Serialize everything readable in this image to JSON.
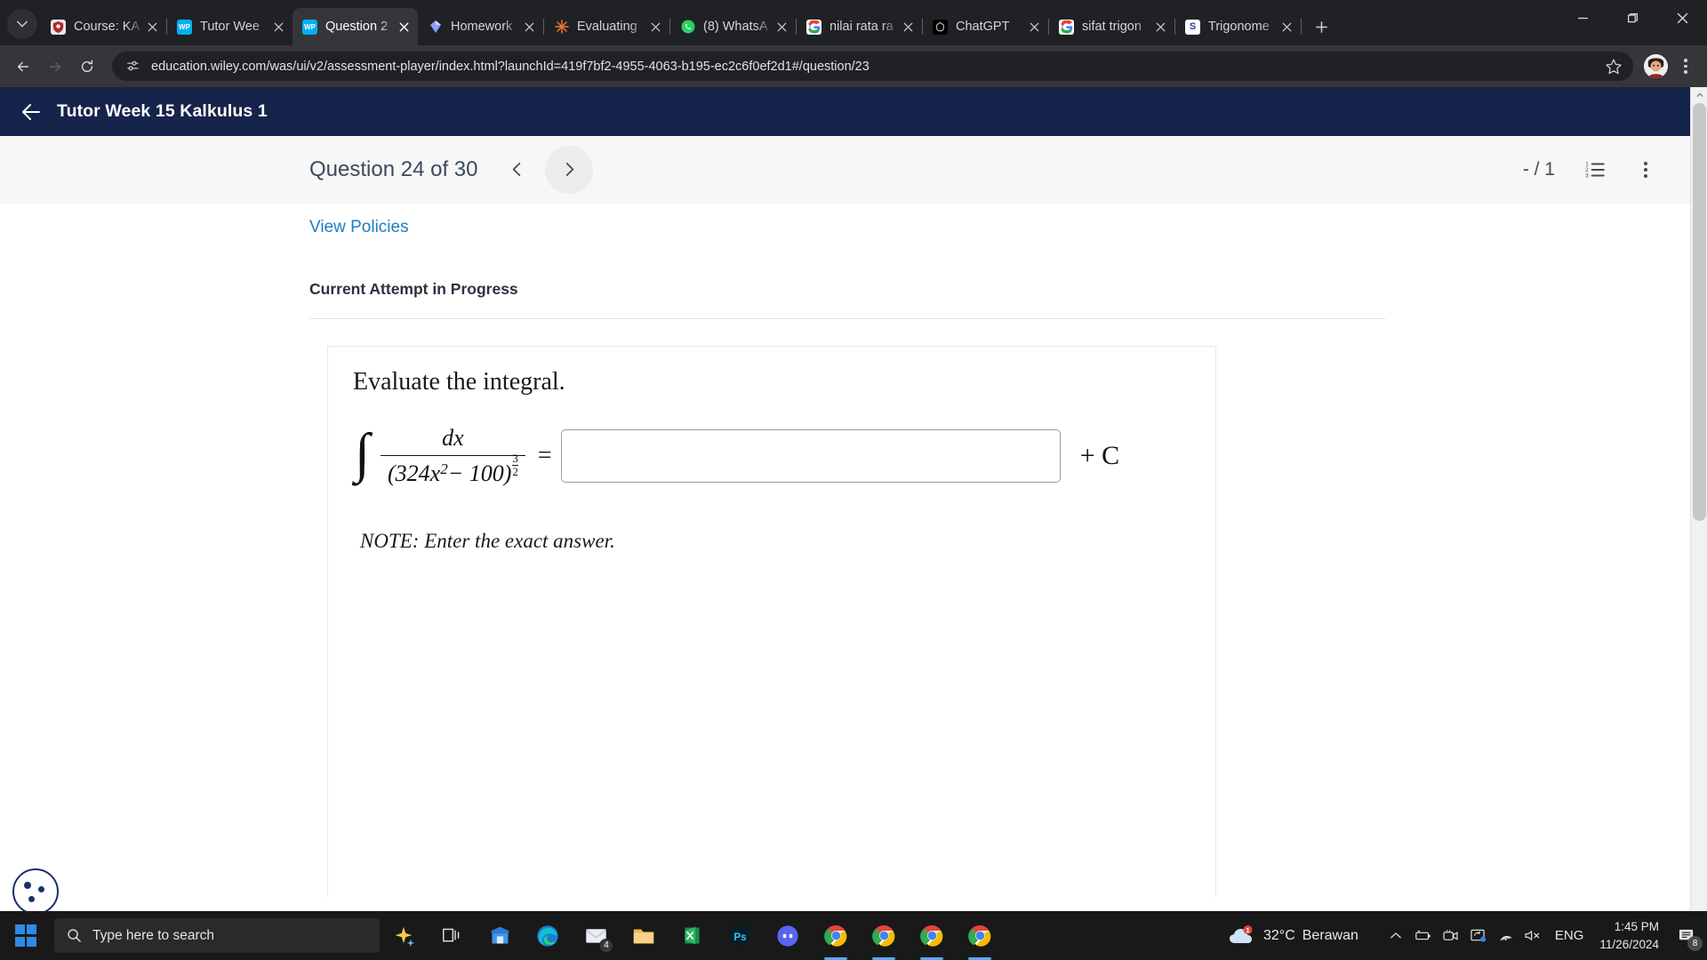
{
  "browser": {
    "tab_search_icon": "chevron-down-icon",
    "new_tab_label": "+",
    "window_controls": {
      "minimize": "minimize",
      "maximize": "maximize",
      "close": "close"
    },
    "tabs": [
      {
        "title": "Course: KA",
        "favicon_text": "K",
        "favicon_color": "#e8e8e8",
        "active": false
      },
      {
        "title": "Tutor Wee",
        "favicon_text": "WP",
        "favicon_color": "#00b0f0",
        "active": false
      },
      {
        "title": "Question 2",
        "favicon_text": "WP",
        "favicon_color": "#00b0f0",
        "active": true
      },
      {
        "title": "Homework",
        "favicon_text": "",
        "favicon_color": "#7b8df0",
        "active": false
      },
      {
        "title": "Evaluating",
        "favicon_text": "",
        "favicon_color": "#f2772a",
        "active": false
      },
      {
        "title": "(8) WhatsA",
        "favicon_text": "",
        "favicon_color": "#25d366",
        "active": false
      },
      {
        "title": "nilai rata ra",
        "favicon_text": "G",
        "favicon_color": "#ffffff",
        "active": false
      },
      {
        "title": "ChatGPT",
        "favicon_text": "",
        "favicon_color": "#000000",
        "active": false
      },
      {
        "title": "sifat trigon",
        "favicon_text": "G",
        "favicon_color": "#ffffff",
        "active": false
      },
      {
        "title": "Trigonome",
        "favicon_text": "S",
        "favicon_color": "#ffffff",
        "active": false
      }
    ],
    "toolbar": {
      "back_label": "Back",
      "forward_label": "Forward",
      "reload_label": "Reload",
      "url": "education.wiley.com/was/ui/v2/assessment-player/index.html?launchId=419f7bf2-4955-4063-b195-ec2c6f0ef2d1#/question/23",
      "site_icon": "site-settings-icon",
      "bookmark_icon": "star-icon",
      "profile_icon": "avatar",
      "menu_icon": "kebab-menu-icon"
    }
  },
  "app": {
    "back_icon": "back-arrow-icon",
    "title": "Tutor Week 15 Kalkulus 1"
  },
  "question_bar": {
    "label": "Question 24 of 30",
    "current": 24,
    "total": 30,
    "prev_icon": "chevron-left-icon",
    "next_icon": "chevron-right-icon",
    "score": "- / 1",
    "list_icon": "numbered-list-icon",
    "more_icon": "kebab-menu-icon"
  },
  "question": {
    "view_policies": "View Policies",
    "attempt_status": "Current Attempt in Progress",
    "prompt": "Evaluate the integral.",
    "math": {
      "integral_sign": "∫",
      "numerator": "dx",
      "denominator_base": "(324x",
      "denominator_sq": "2",
      "denominator_rest": " − 100)",
      "exponent_num": "3",
      "exponent_den": "2",
      "equals": "=",
      "plus_c": "+ C"
    },
    "answer_value": "",
    "answer_placeholder": "",
    "note": "NOTE: Enter the exact answer."
  },
  "cookie_widget": {
    "name": "cookie-preferences"
  },
  "taskbar": {
    "start_label": "Start",
    "search_placeholder": "Type here to search",
    "search_icon": "search-icon",
    "icons": [
      {
        "name": "copilot-icon",
        "badge": ""
      },
      {
        "name": "task-view-icon",
        "badge": ""
      },
      {
        "name": "microsoft-store-icon",
        "badge": ""
      },
      {
        "name": "edge-icon",
        "badge": ""
      },
      {
        "name": "mail-icon",
        "badge": "4"
      },
      {
        "name": "file-explorer-icon",
        "badge": ""
      },
      {
        "name": "excel-icon",
        "badge": ""
      },
      {
        "name": "photoshop-icon",
        "badge": "Ps"
      },
      {
        "name": "discord-icon",
        "badge": ""
      },
      {
        "name": "chrome-icon-1",
        "badge": ""
      },
      {
        "name": "chrome-icon-2",
        "badge": ""
      },
      {
        "name": "chrome-icon-3",
        "badge": ""
      },
      {
        "name": "chrome-icon-4",
        "badge": ""
      }
    ],
    "weather": {
      "temperature": "32°C",
      "condition": "Berawan"
    },
    "tray": {
      "show_hidden_icon": "chevron-up-icon",
      "battery_icon": "battery-icon",
      "camera_icon": "camera-icon",
      "screenshot_icon": "screenshot-icon",
      "wifi_icon": "wifi-icon",
      "volume_icon": "volume-muted-icon"
    },
    "language": "ENG",
    "time": "1:45 PM",
    "date": "11/26/2024",
    "notification_count": "8",
    "notification_icon": "notification-icon"
  },
  "colors": {
    "appbar": "#16234a",
    "link": "#1b7fc4",
    "chrome_dark": "#202124",
    "chrome_toolbar": "#35363a",
    "taskbar": "#191919"
  }
}
